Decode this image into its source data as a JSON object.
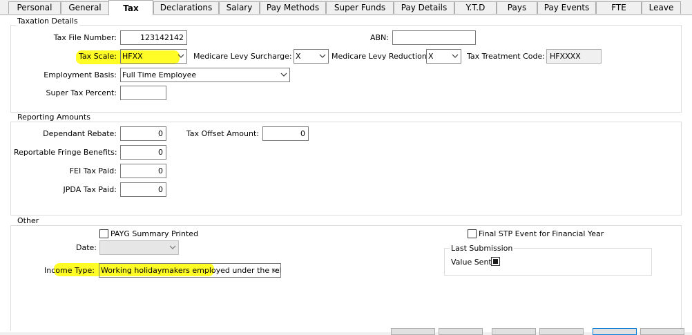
{
  "tabs": [
    "Personal",
    "General",
    "Tax",
    "Declarations",
    "Salary",
    "Pay Methods",
    "Super Funds",
    "Pay Details",
    "Y.T.D",
    "Pays",
    "Pay Events",
    "FTE",
    "Leave"
  ],
  "active_tab": "Tax",
  "taxation": {
    "title": "Taxation Details",
    "tfn_label": "Tax File Number:",
    "tfn_value": "123142142",
    "abn_label": "ABN:",
    "abn_value": "",
    "tax_scale_label": "Tax Scale:",
    "tax_scale_value": "HFXX",
    "medicare_surcharge_label": "Medicare Levy Surcharge:",
    "medicare_surcharge_value": "X",
    "medicare_reduction_label": "Medicare Levy Reduction:",
    "medicare_reduction_value": "X",
    "treatment_code_label": "Tax Treatment Code:",
    "treatment_code_value": "HFXXXX",
    "employment_basis_label": "Employment Basis:",
    "employment_basis_value": "Full Time Employee",
    "super_tax_label": "Super Tax Percent:",
    "super_tax_value": ""
  },
  "reporting": {
    "title": "Reporting Amounts",
    "dependant_label": "Dependant Rebate:",
    "dependant_value": "0",
    "offset_label": "Tax Offset Amount:",
    "offset_value": "0",
    "fringe_label": "Reportable Fringe Benefits:",
    "fringe_value": "0",
    "fei_label": "FEI Tax Paid:",
    "fei_value": "0",
    "jpda_label": "JPDA Tax Paid:",
    "jpda_value": "0"
  },
  "other": {
    "title": "Other",
    "payg_label": "PAYG Summary Printed",
    "payg_checked": false,
    "date_label": "Date:",
    "date_value": "",
    "income_type_label": "Income Type:",
    "income_type_value": "Working holidaymakers employed under the releva",
    "final_stp_label": "Final STP Event for Financial Year",
    "final_stp_checked": false,
    "last_submission_title": "Last Submission",
    "value_sent_label": "Value Sent:",
    "value_sent_checked": true
  },
  "colors": {
    "highlight": "#fffb00"
  }
}
